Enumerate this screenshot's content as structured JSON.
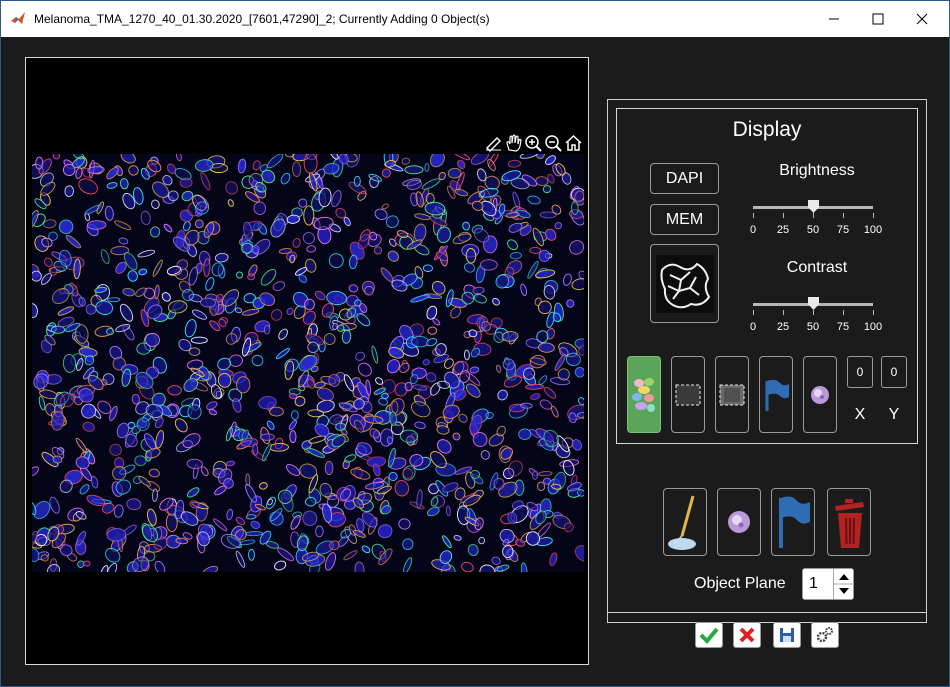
{
  "window": {
    "title": "Melanoma_TMA_1270_40_01.30.2020_[7601,47290]_2; Currently Adding 0 Object(s)"
  },
  "display": {
    "title": "Display",
    "dapi_label": "DAPI",
    "mem_label": "MEM",
    "brightness": {
      "label": "Brightness",
      "value": 50,
      "ticks": [
        "0",
        "25",
        "50",
        "75",
        "100"
      ]
    },
    "contrast": {
      "label": "Contrast",
      "value": 50,
      "ticks": [
        "0",
        "25",
        "50",
        "75",
        "100"
      ]
    },
    "x_value": "0",
    "y_value": "0",
    "x_label": "X",
    "y_label": "Y"
  },
  "object_plane": {
    "label": "Object Plane",
    "value": "1"
  },
  "colors": {
    "background": "#1b1b1b",
    "active_tool": "#5aa55a",
    "flag": "#2e6db4",
    "trash": "#b22222",
    "confirm": "#22aa44",
    "cancel": "#dd2222",
    "tissue_nuclei": "#2a2ab0"
  }
}
